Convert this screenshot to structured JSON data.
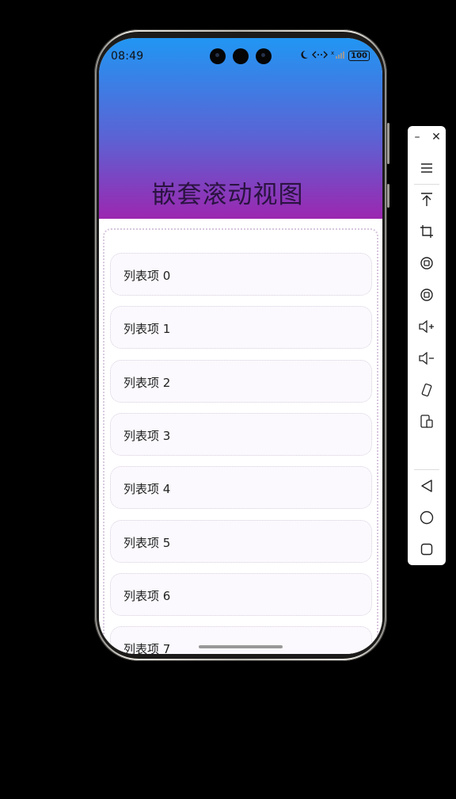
{
  "status_bar": {
    "time": "08:49",
    "battery": "100",
    "icons": [
      "moon-icon",
      "signal-arrows-icon",
      "wifi-off-icon",
      "battery-icon"
    ]
  },
  "header": {
    "title": "嵌套滚动视图",
    "gradient_top": "#2196f3",
    "gradient_bottom": "#9c27b0"
  },
  "list": {
    "items": [
      {
        "label": "列表项 0"
      },
      {
        "label": "列表项 1"
      },
      {
        "label": "列表项 2"
      },
      {
        "label": "列表项 3"
      },
      {
        "label": "列表项 4"
      },
      {
        "label": "列表项 5"
      },
      {
        "label": "列表项 6"
      },
      {
        "label": "列表项 7"
      }
    ]
  },
  "toolbar": {
    "buttons": [
      "minimize-icon",
      "close-icon",
      "menu-icon",
      "pin-top-icon",
      "crop-icon",
      "rotate-left-icon",
      "rotate-right-icon",
      "volume-up-icon",
      "volume-down-icon",
      "shake-icon",
      "fold-icon",
      "back-icon",
      "home-icon",
      "recents-icon"
    ]
  }
}
